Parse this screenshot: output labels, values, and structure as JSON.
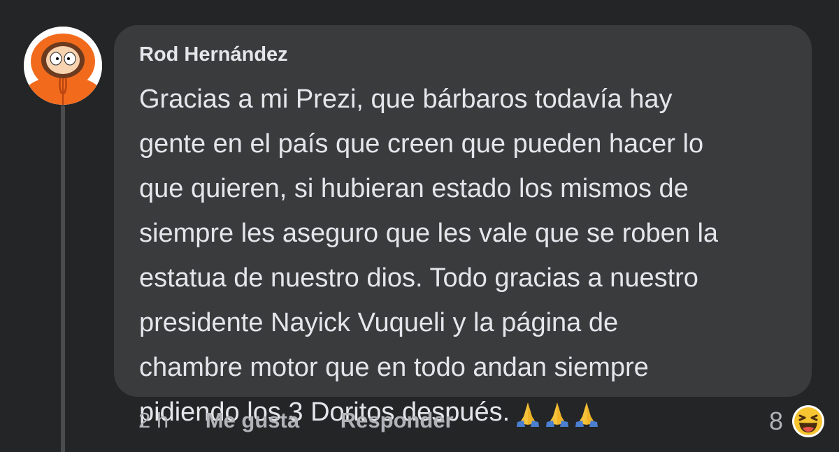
{
  "comment": {
    "author": "Rod Hernández",
    "avatar_icon": "kenny-avatar-icon",
    "text": "Gracias a mi Prezi, que bárbaros todavía hay\ngente en el país que creen que pueden hacer lo\nque quieren, si hubieran estado los mismos de\nsiempre les aseguro que les vale que se roben la\nestatua de nuestro dios. Todo gracias a nuestro\npresidente Nayick Vuqueli y la página de\nchambre motor que en todo andan siempre\npidiendo los 3 Doritos después.",
    "trailing_emoji": "folded-hands-icon x3"
  },
  "actions": {
    "time": "2 h",
    "like_label": "Me gusta",
    "reply_label": "Responder"
  },
  "reactions": {
    "count": "8",
    "icon": "haha-reaction-icon"
  },
  "colors": {
    "background": "#242526",
    "bubble": "#3a3b3c",
    "text": "#e4e6eb",
    "secondary_text": "#b0b3b8",
    "avatar_orange": "#f26b1d"
  }
}
